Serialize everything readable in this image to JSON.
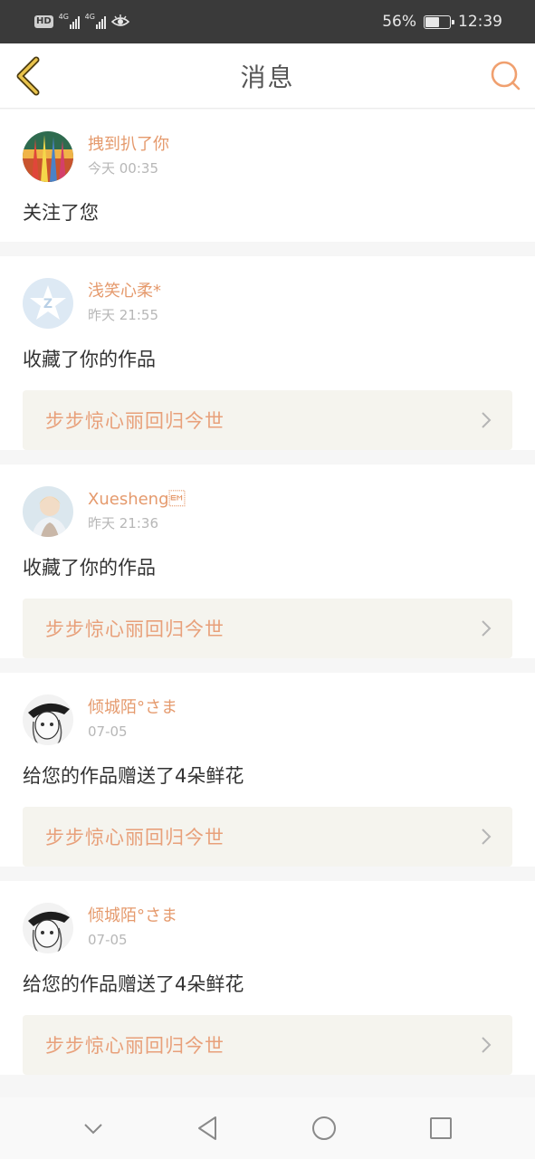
{
  "status_bar": {
    "hd": "HD",
    "net1": "4G",
    "net2": "4G",
    "battery_pct": "56%",
    "time": "12:39"
  },
  "header": {
    "title": "消息",
    "back_icon": "chevron-left-icon",
    "search_icon": "search-icon"
  },
  "colors": {
    "accent": "#e59a6d",
    "work_bg": "#f5f4ee",
    "work_text": "#e8a07a"
  },
  "messages": [
    {
      "user": "拽到扒了你",
      "time": "今天 00:35",
      "action": "关注了您",
      "work": ""
    },
    {
      "user": "浅笑心柔*",
      "time": "昨天 21:55",
      "action": "收藏了你的作品",
      "work": "步步惊心丽回归今世"
    },
    {
      "user": "Xuesheng\u0019",
      "time": "昨天 21:36",
      "action": "收藏了你的作品",
      "work": "步步惊心丽回归今世"
    },
    {
      "user": "倾城陌°さま",
      "time": "07-05",
      "action": "给您的作品赠送了4朵鲜花",
      "work": "步步惊心丽回归今世"
    },
    {
      "user": "倾城陌°さま",
      "time": "07-05",
      "action": "给您的作品赠送了4朵鲜花",
      "work": "步步惊心丽回归今世"
    }
  ],
  "nav": {
    "down_icon": "chevron-down-icon",
    "back_icon": "triangle-back-icon",
    "home_icon": "circle-home-icon",
    "recent_icon": "square-recents-icon"
  }
}
